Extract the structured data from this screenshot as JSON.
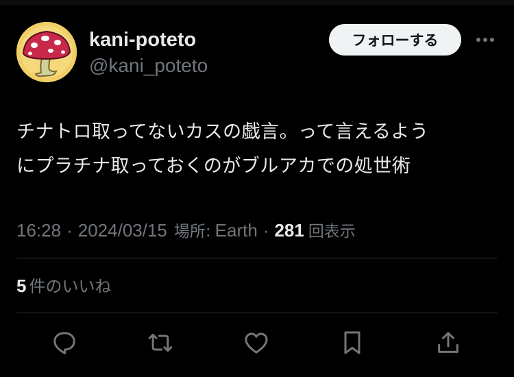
{
  "user": {
    "display_name": "kani-poteto",
    "handle": "@kani_poteto",
    "avatar_icon": "mushroom-icon"
  },
  "follow_button": {
    "label": "フォローする"
  },
  "more_menu": {
    "icon": "more-horizontal-icon"
  },
  "tweet": {
    "lines": [
      "チナトロ取ってないカスの戯言。って言えるよう",
      "にプラチナ取っておくのがブルアカでの処世術"
    ]
  },
  "meta": {
    "time": "16:28",
    "separator": "·",
    "date": "2024/03/15",
    "location_label": "場所:",
    "location": "Earth",
    "views_count": "281",
    "views_label": "回表示"
  },
  "likes": {
    "count": "5",
    "label": "件のいいね"
  },
  "actions": [
    {
      "icon": "reply-icon"
    },
    {
      "icon": "retweet-icon"
    },
    {
      "icon": "like-icon"
    },
    {
      "icon": "bookmark-icon"
    },
    {
      "icon": "share-icon"
    }
  ],
  "colors": {
    "background": "#000000",
    "primary_text": "#e7e9ea",
    "secondary_text": "#71767b",
    "divider": "#2f3336",
    "follow_button_bg": "#eff3f4",
    "follow_button_text": "#0f1419",
    "mushroom_cap": "#c8294a",
    "avatar_bg": "#f1cf66"
  }
}
